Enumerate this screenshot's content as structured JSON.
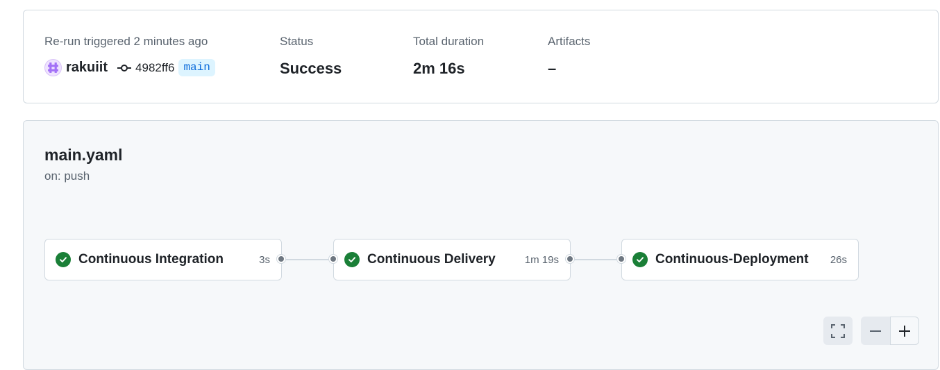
{
  "summary": {
    "trigger_label": "Re-run triggered 2 minutes ago",
    "actor": "rakuiit",
    "commit_sha": "4982ff6",
    "branch": "main",
    "status_label": "Status",
    "status_value": "Success",
    "duration_label": "Total duration",
    "duration_value": "2m 16s",
    "artifacts_label": "Artifacts",
    "artifacts_value": "–"
  },
  "workflow": {
    "name": "main.yaml",
    "trigger": "on: push",
    "jobs": [
      {
        "name": "Continuous Integration",
        "duration": "3s",
        "status": "success"
      },
      {
        "name": "Continuous Delivery",
        "duration": "1m 19s",
        "status": "success"
      },
      {
        "name": "Continuous-Deployment",
        "duration": "26s",
        "status": "success"
      }
    ]
  },
  "icons": {
    "avatar": "identicon-avatar",
    "commit": "git-commit-icon",
    "job_status": "check-circle-fill-icon",
    "fullscreen": "screen-full-icon",
    "zoom_out": "dash-icon",
    "zoom_in": "plus-icon"
  },
  "colors": {
    "success": "#1a7f37",
    "branch_text": "#0969da",
    "branch_bg": "#ddf4ff",
    "muted_text": "#59636e"
  }
}
